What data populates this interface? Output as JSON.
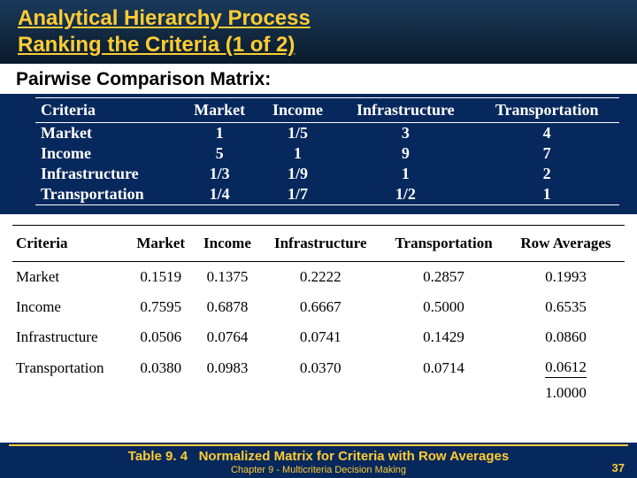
{
  "title_line1": "Analytical Hierarchy Process",
  "title_line2": "Ranking the Criteria (1 of 2)",
  "subtitle": "Pairwise Comparison Matrix:",
  "matrix": {
    "headers": [
      "Criteria",
      "Market",
      "Income",
      "Infrastructure",
      "Transportation"
    ],
    "rows": [
      {
        "label": "Market",
        "c": [
          "1",
          "1/5",
          "3",
          "4"
        ]
      },
      {
        "label": "Income",
        "c": [
          "5",
          "1",
          "9",
          "7"
        ]
      },
      {
        "label": "Infrastructure",
        "c": [
          "1/3",
          "1/9",
          "1",
          "2"
        ]
      },
      {
        "label": "Transportation",
        "c": [
          "1/4",
          "1/7",
          "1/2",
          "1"
        ]
      }
    ]
  },
  "norm": {
    "headers": [
      "Criteria",
      "Market",
      "Income",
      "Infrastructure",
      "Transportation",
      "Row Averages"
    ],
    "rows": [
      {
        "label": "Market",
        "c": [
          "0.1519",
          "0.1375",
          "0.2222",
          "0.2857",
          "0.1993"
        ]
      },
      {
        "label": "Income",
        "c": [
          "0.7595",
          "0.6878",
          "0.6667",
          "0.5000",
          "0.6535"
        ]
      },
      {
        "label": "Infrastructure",
        "c": [
          "0.0506",
          "0.0764",
          "0.0741",
          "0.1429",
          "0.0860"
        ]
      },
      {
        "label": "Transportation",
        "c": [
          "0.0380",
          "0.0983",
          "0.0370",
          "0.0714",
          "0.0612"
        ]
      }
    ],
    "sum": "1.0000"
  },
  "caption_label": "Table 9. 4",
  "caption_text": "Normalized Matrix for Criteria with Row Averages",
  "chapter": "Chapter 9 - Multicriteria Decision Making",
  "page": "37",
  "chart_data": [
    {
      "type": "table",
      "title": "Pairwise Comparison Matrix",
      "categories": [
        "Market",
        "Income",
        "Infrastructure",
        "Transportation"
      ],
      "series": [
        {
          "name": "Market",
          "values": [
            "1",
            "1/5",
            "3",
            "4"
          ]
        },
        {
          "name": "Income",
          "values": [
            "5",
            "1",
            "9",
            "7"
          ]
        },
        {
          "name": "Infrastructure",
          "values": [
            "1/3",
            "1/9",
            "1",
            "2"
          ]
        },
        {
          "name": "Transportation",
          "values": [
            "1/4",
            "1/7",
            "1/2",
            "1"
          ]
        }
      ]
    },
    {
      "type": "table",
      "title": "Normalized Matrix for Criteria with Row Averages",
      "categories": [
        "Market",
        "Income",
        "Infrastructure",
        "Transportation",
        "Row Averages"
      ],
      "series": [
        {
          "name": "Market",
          "values": [
            0.1519,
            0.1375,
            0.2222,
            0.2857,
            0.1993
          ]
        },
        {
          "name": "Income",
          "values": [
            0.7595,
            0.6878,
            0.6667,
            0.5,
            0.6535
          ]
        },
        {
          "name": "Infrastructure",
          "values": [
            0.0506,
            0.0764,
            0.0741,
            0.1429,
            0.086
          ]
        },
        {
          "name": "Transportation",
          "values": [
            0.038,
            0.0983,
            0.037,
            0.0714,
            0.0612
          ]
        }
      ],
      "annotations": {
        "row_average_sum": 1.0
      }
    }
  ]
}
